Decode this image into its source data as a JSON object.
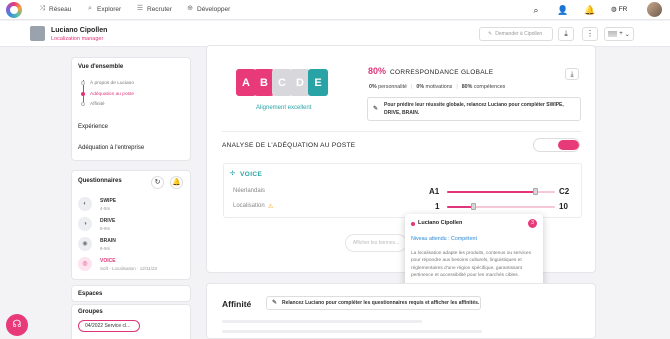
{
  "nav": {
    "items": [
      {
        "label": "Réseau",
        "icon": "network-icon"
      },
      {
        "label": "Explorer",
        "icon": "explore-icon"
      },
      {
        "label": "Recruter",
        "icon": "recruit-icon"
      },
      {
        "label": "Développer",
        "icon": "develop-icon"
      }
    ],
    "lang": "FR"
  },
  "profile": {
    "name": "Luciano Cipollen",
    "role": "Localization manager",
    "request_label": "Demander à Cipollen"
  },
  "overview": {
    "title": "Vue d'ensemble",
    "items": [
      "À propos de Luciano",
      "Adéquation au poste",
      "Affinité"
    ],
    "experience": "Expérience",
    "company_fit": "Adéquation à l'entreprise"
  },
  "questionnaires": {
    "title": "Questionnaires",
    "items": [
      {
        "name": "SWIPE",
        "sub": "4-5m"
      },
      {
        "name": "DRIVE",
        "sub": "8-9m"
      },
      {
        "name": "BRAIN",
        "sub": "8-9m"
      },
      {
        "name": "VOICE",
        "sub": "Soft - Localisation · 12/11/23"
      }
    ]
  },
  "spaces": {
    "title": "Espaces"
  },
  "groups": {
    "title": "Groupes",
    "chip": "04/2022 Service cl..."
  },
  "match": {
    "letters": [
      "A",
      "B",
      "C",
      "D",
      "E"
    ],
    "letter_colors": [
      "#e83a78",
      "#e83a78",
      "#d8d8dc",
      "#d8d8dc",
      "#2aa3a6"
    ],
    "alignment": "Alignement excellent",
    "pct": "80%",
    "label": "CORRESPONDANCE GLOBALE",
    "stats": [
      {
        "value": "0%",
        "label": "personnalité"
      },
      {
        "value": "0%",
        "label": "motivations"
      },
      {
        "value": "80%",
        "label": "compétences"
      }
    ],
    "tip": "Pour prédire leur réussite globale, relancez Luciano pour compléter SWIPE, DRIVE, BRAIN."
  },
  "fit": {
    "title": "ANALYSE DE L'ADÉQUATION AU POSTE",
    "toggle_off": "",
    "toggle_on": "",
    "voice": {
      "title": "VOICE",
      "criteria": [
        {
          "label": "Néerlandais",
          "from": "A1",
          "to": "C2",
          "fill": 0.82
        },
        {
          "label": "Localisation",
          "from": "1",
          "to": "10",
          "fill": 0.25
        }
      ]
    },
    "ghost_button": "Afficher les bonnes..."
  },
  "popover": {
    "name": "Luciano Cipollen",
    "badge": "3",
    "level": "Niveau attendu : Compétent",
    "text": "La localisation adapte les produits, contenus ou services pour répondre aux besoins culturels, linguistiques et réglementaires d'une région spécifique, garantissant pertinence et accessibilité pour les marchés cibles."
  },
  "affinity": {
    "title": "Affinité",
    "button": "Relancez Luciano pour compléter les questionnaires requis et afficher les affinités."
  }
}
